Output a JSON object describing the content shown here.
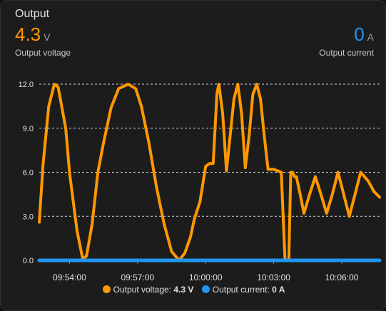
{
  "card": {
    "title": "Output"
  },
  "voltage": {
    "value": "4.3",
    "unit": "V",
    "label": "Output voltage",
    "color": "#ff9800"
  },
  "current": {
    "value": "0",
    "unit": "A",
    "label": "Output current",
    "color": "#2196f3"
  },
  "legend": {
    "voltage_label": "Output voltage:",
    "voltage_value": "4.3 V",
    "current_label": "Output current:",
    "current_value": "0 A"
  },
  "chart_data": {
    "type": "line",
    "ylim": [
      0,
      12
    ],
    "yticks": [
      "0.0",
      "3.0",
      "6.0",
      "9.0",
      "12.0"
    ],
    "x_range": [
      "09:52:40",
      "10:07:40"
    ],
    "xticks": [
      "09:54:00",
      "09:57:00",
      "10:00:00",
      "10:03:00",
      "10:06:00"
    ],
    "grid": true,
    "legend_position": "bottom",
    "series": [
      {
        "name": "Output voltage",
        "color": "#ff9800",
        "x": [
          "09:52:40",
          "09:52:50",
          "09:53:05",
          "09:53:20",
          "09:53:30",
          "09:53:50",
          "09:54:00",
          "09:54:20",
          "09:54:35",
          "09:54:45",
          "09:55:00",
          "09:55:15",
          "09:55:30",
          "09:55:50",
          "09:56:10",
          "09:56:35",
          "09:56:55",
          "09:57:10",
          "09:57:30",
          "09:57:50",
          "09:58:10",
          "09:58:30",
          "09:58:50",
          "09:59:05",
          "09:59:20",
          "09:59:30",
          "09:59:45",
          "10:00:00",
          "10:00:10",
          "10:00:20",
          "10:00:30",
          "10:00:35",
          "10:00:45",
          "10:00:55",
          "10:01:05",
          "10:01:15",
          "10:01:25",
          "10:01:35",
          "10:01:45",
          "10:01:55",
          "10:02:05",
          "10:02:15",
          "10:02:25",
          "10:02:35",
          "10:02:45",
          "10:03:00",
          "10:03:10",
          "10:03:20",
          "10:03:30",
          "10:03:40",
          "10:03:45",
          "10:03:50",
          "10:03:55",
          "10:04:00",
          "10:04:10",
          "10:04:20",
          "10:04:35",
          "10:04:50",
          "10:05:05",
          "10:05:20",
          "10:05:35",
          "10:05:50",
          "10:06:05",
          "10:06:20",
          "10:06:35",
          "10:06:50",
          "10:07:10",
          "10:07:25",
          "10:07:40"
        ],
        "y": [
          2.6,
          6.5,
          10.5,
          12.0,
          11.8,
          9.0,
          6.0,
          2.0,
          0.1,
          0.3,
          2.5,
          6.0,
          8.0,
          10.4,
          11.7,
          12.0,
          11.7,
          10.5,
          8.0,
          5.0,
          2.5,
          0.6,
          0.0,
          0.5,
          1.6,
          2.8,
          4.0,
          6.4,
          6.6,
          6.6,
          11.4,
          12.0,
          10.0,
          6.1,
          8.5,
          11.0,
          12.0,
          10.0,
          6.3,
          8.5,
          11.3,
          12.0,
          11.0,
          8.5,
          6.2,
          6.2,
          6.1,
          6.0,
          0.0,
          0.0,
          6.0,
          6.0,
          5.7,
          5.7,
          4.5,
          3.2,
          4.5,
          5.7,
          4.5,
          3.2,
          4.5,
          6.0,
          4.5,
          3.0,
          4.5,
          6.0,
          5.4,
          4.7,
          4.3
        ]
      },
      {
        "name": "Output current",
        "color": "#2196f3",
        "x": [
          "09:52:40",
          "10:07:40"
        ],
        "y": [
          0,
          0
        ]
      }
    ]
  }
}
